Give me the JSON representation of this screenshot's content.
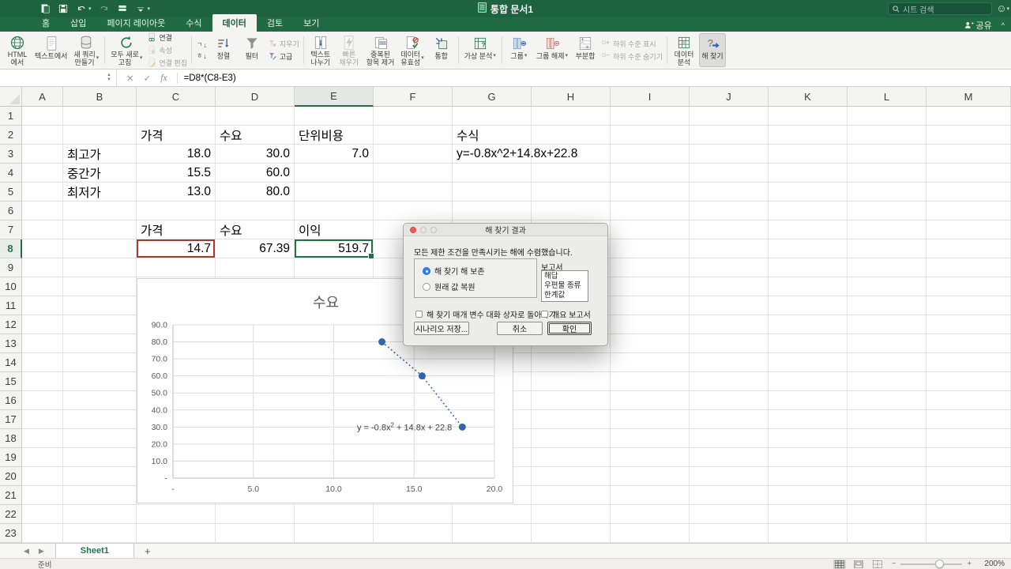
{
  "colors": {
    "accent_green": "#217346",
    "selection_red": "#a23b30",
    "point_blue": "#3565ad",
    "mac_blue": "#2f7cf6"
  },
  "titlebar": {
    "title": "통합 문서1",
    "search_placeholder": "시트 검색",
    "qat": [
      {
        "icon": "new-doc"
      },
      {
        "icon": "save"
      },
      {
        "icon": "undo",
        "dropdown": true
      },
      {
        "icon": "redo",
        "disabled": true
      },
      {
        "icon": "print"
      },
      {
        "icon": "customize-toolbar",
        "dropdown": true
      }
    ]
  },
  "tabs": {
    "items": [
      "홈",
      "삽입",
      "페이지 레이아웃",
      "수식",
      "데이터",
      "검토",
      "보기"
    ],
    "active": "데이터",
    "share_label": "공유"
  },
  "ribbon": {
    "groups": [
      {
        "name": "external-data",
        "items": [
          {
            "type": "large",
            "icon": "html-globe",
            "label": "HTML\n에서"
          },
          {
            "type": "large",
            "icon": "text-file",
            "label": "텍스트에서"
          },
          {
            "type": "large",
            "icon": "new-query",
            "label": "새 쿼리\n만들기",
            "dropdown": true
          }
        ]
      },
      {
        "name": "connections",
        "items": [
          {
            "type": "large",
            "icon": "refresh-all",
            "label": "모두 새로\n고침",
            "dropdown": true
          },
          {
            "type": "stack",
            "items": [
              {
                "icon": "connections",
                "label": "연결"
              },
              {
                "icon": "properties",
                "label": "속성",
                "disabled": true
              },
              {
                "icon": "edit-links",
                "label": "연결 편집",
                "disabled": true
              }
            ]
          }
        ]
      },
      {
        "name": "sort-filter",
        "items": [
          {
            "type": "sortpair"
          },
          {
            "type": "large",
            "icon": "sort",
            "label": "정렬"
          },
          {
            "type": "large",
            "icon": "filter",
            "label": "필터"
          },
          {
            "type": "stack",
            "items": [
              {
                "icon": "clear-filter",
                "label": "지우기",
                "disabled": true
              },
              {
                "icon": "advanced-filter",
                "label": "고급"
              }
            ]
          }
        ]
      },
      {
        "name": "data-tools",
        "items": [
          {
            "type": "large",
            "icon": "text-to-columns",
            "label": "텍스트\n나누기"
          },
          {
            "type": "large",
            "icon": "flash-fill",
            "label": "빠른\n채우기",
            "disabled": true
          },
          {
            "type": "large",
            "icon": "remove-duplicates",
            "label": "중복된\n항목 제거"
          },
          {
            "type": "large",
            "icon": "data-validation",
            "label": "데이터\n유효성",
            "dropdown": true
          },
          {
            "type": "large",
            "icon": "consolidate",
            "label": "통합"
          }
        ]
      },
      {
        "name": "forecast",
        "items": [
          {
            "type": "large",
            "icon": "what-if",
            "label": "가상 분석",
            "dropdown": true
          }
        ]
      },
      {
        "name": "outline",
        "items": [
          {
            "type": "large",
            "icon": "group",
            "label": "그룹",
            "dropdown": true
          },
          {
            "type": "large",
            "icon": "ungroup",
            "label": "그룹 해제",
            "dropdown": true
          },
          {
            "type": "large",
            "icon": "subtotal",
            "label": "부분합"
          },
          {
            "type": "stack",
            "items": [
              {
                "icon": "show-detail",
                "label": "하위 수준 표시",
                "disabled": true
              },
              {
                "icon": "hide-detail",
                "label": "하위 수준 숨기기",
                "disabled": true
              }
            ]
          }
        ]
      },
      {
        "name": "analysis",
        "items": [
          {
            "type": "large",
            "icon": "data-analysis",
            "label": "데이터\n분석"
          },
          {
            "type": "large",
            "icon": "solver",
            "label": "해 찾기",
            "active": true
          }
        ]
      }
    ]
  },
  "formula_bar": {
    "name_box": "",
    "cancel_icon": "✕",
    "enter_icon": "✓",
    "fx_label": "fx",
    "formula": "=D8*(C8-E3)"
  },
  "grid": {
    "columns": [
      "A",
      "B",
      "C",
      "D",
      "E",
      "F",
      "G",
      "H",
      "I",
      "J",
      "K",
      "L",
      "M"
    ],
    "row_count": 23,
    "selected_column": "E",
    "selected_row": 8,
    "cells": [
      {
        "ref": "C2",
        "text": "가격",
        "align": "left"
      },
      {
        "ref": "D2",
        "text": "수요",
        "align": "left"
      },
      {
        "ref": "E2",
        "text": "단위비용",
        "align": "left"
      },
      {
        "ref": "G2",
        "text": "수식",
        "align": "left"
      },
      {
        "ref": "B3",
        "text": "최고가",
        "align": "left"
      },
      {
        "ref": "C3",
        "text": "18.0",
        "align": "right"
      },
      {
        "ref": "D3",
        "text": "30.0",
        "align": "right"
      },
      {
        "ref": "E3",
        "text": "7.0",
        "align": "right"
      },
      {
        "ref": "G3",
        "text": "y=-0.8x^2+14.8x+22.8",
        "align": "left",
        "spill": true
      },
      {
        "ref": "B4",
        "text": "중간가",
        "align": "left"
      },
      {
        "ref": "C4",
        "text": "15.5",
        "align": "right"
      },
      {
        "ref": "D4",
        "text": "60.0",
        "align": "right"
      },
      {
        "ref": "B5",
        "text": "최저가",
        "align": "left"
      },
      {
        "ref": "C5",
        "text": "13.0",
        "align": "right"
      },
      {
        "ref": "D5",
        "text": "80.0",
        "align": "right"
      },
      {
        "ref": "C7",
        "text": "가격",
        "align": "left"
      },
      {
        "ref": "D7",
        "text": "수요",
        "align": "left"
      },
      {
        "ref": "E7",
        "text": "이익",
        "align": "left"
      },
      {
        "ref": "C8",
        "text": "14.7",
        "align": "right",
        "border": "red"
      },
      {
        "ref": "D8",
        "text": "67.39",
        "align": "right"
      },
      {
        "ref": "E8",
        "text": "519.7",
        "align": "right",
        "selected": true
      }
    ]
  },
  "chart_data": {
    "type": "scatter",
    "title": "수요",
    "series": [
      {
        "name": "수요",
        "points": [
          [
            13,
            80
          ],
          [
            15.5,
            60
          ],
          [
            18,
            30
          ]
        ]
      }
    ],
    "line_style": "dotted",
    "marker_color": "#3565ad",
    "xlim": [
      0,
      20
    ],
    "ylim": [
      0,
      90
    ],
    "xticks": {
      "values": [
        0,
        5,
        10,
        15,
        20
      ],
      "labels": [
        "-",
        "5.0",
        "10.0",
        "15.0",
        "20.0"
      ]
    },
    "yticks": {
      "values": [
        0,
        10,
        20,
        30,
        40,
        50,
        60,
        70,
        80,
        90
      ],
      "labels": [
        "-",
        "10.0",
        "20.0",
        "30.0",
        "40.0",
        "50.0",
        "60.0",
        "70.0",
        "80.0",
        "90.0"
      ]
    },
    "grid": true,
    "legend": "none",
    "annotation": {
      "text": "y = -0.8x2 + 14.8x + 22.8",
      "prefix": "y = -0.8x",
      "sup": "2",
      "suffix": " + 14.8x + 22.8",
      "at_point": [
        18,
        30
      ]
    }
  },
  "dialog": {
    "title": "해 찾기 결과",
    "message": "모든 제한 조건을 만족시키는 해에 수렴했습니다.",
    "radio_keep": "해 찾기 해 보존",
    "radio_restore": "원래 값 복원",
    "radio_selected": "해 찾기 해 보존",
    "reports_label": "보고서",
    "reports": [
      "해답",
      "우편물 종류",
      "한계값"
    ],
    "checkbox_return": "해 찾기 매개 변수 대화 상자로 돌아가기",
    "checkbox_outline": "개요 보고서",
    "buttons": {
      "save_scenario": "시나리오 저장...",
      "cancel": "취소",
      "ok": "확인"
    }
  },
  "sheet_bar": {
    "tabs": [
      "Sheet1"
    ],
    "active": "Sheet1",
    "add_label": "+"
  },
  "status_bar": {
    "ready": "준비",
    "zoom": "200%"
  }
}
